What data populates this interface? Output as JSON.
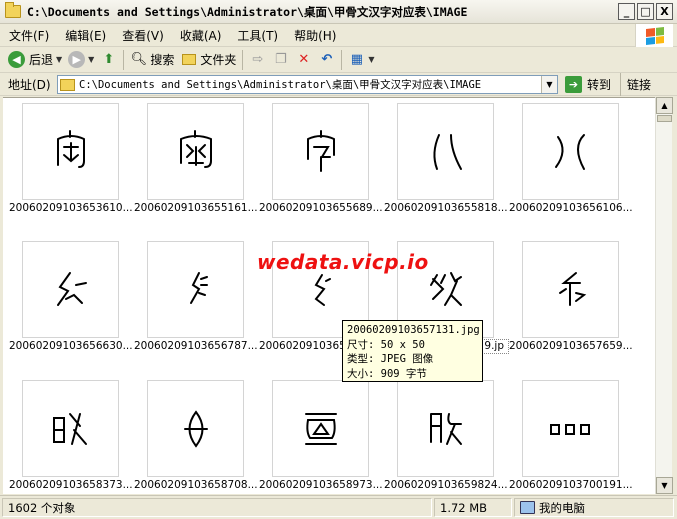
{
  "window": {
    "title": "C:\\Documents and Settings\\Administrator\\桌面\\甲骨文汉字对应表\\IMAGE",
    "minimize": "_",
    "maximize": "□",
    "close": "X"
  },
  "menu": [
    "文件(F)",
    "编辑(E)",
    "查看(V)",
    "收藏(A)",
    "工具(T)",
    "帮助(H)"
  ],
  "toolbar": {
    "back_label": "后退",
    "search_label": "搜索",
    "folders_label": "文件夹"
  },
  "address": {
    "label": "地址(D)",
    "value": "C:\\Documents and Settings\\Administrator\\桌面\\甲骨文汉字对应表\\IMAGE",
    "go_label": "转到",
    "links_label": "链接"
  },
  "files": [
    {
      "label": "20060209103653610...",
      "glyph": "g1"
    },
    {
      "label": "20060209103655161...",
      "glyph": "g2"
    },
    {
      "label": "20060209103655689...",
      "glyph": "g3"
    },
    {
      "label": "20060209103655818...",
      "glyph": "g4"
    },
    {
      "label": "20060209103656106...",
      "glyph": "g5"
    },
    {
      "label": "20060209103656630...",
      "glyph": "g6"
    },
    {
      "label": "20060209103656787...",
      "glyph": "g7"
    },
    {
      "label": "20060209103657",
      "glyph": "g8"
    },
    {
      "label": "9.jp",
      "glyph": "g9"
    },
    {
      "label": "20060209103657659...",
      "glyph": "g10"
    },
    {
      "label": "20060209103658373...",
      "glyph": "g11"
    },
    {
      "label": "20060209103658708...",
      "glyph": "g12"
    },
    {
      "label": "20060209103658973...",
      "glyph": "g13"
    },
    {
      "label": "20060209103659824...",
      "glyph": "g14"
    },
    {
      "label": "20060209103700191...",
      "glyph": "g15"
    }
  ],
  "tooltip": {
    "name": "20060209103657131.jpg",
    "size_dims": "尺寸: 50 x 50",
    "type": "类型: JPEG 图像",
    "filesize": "大小: 909 字节"
  },
  "watermark": "wedata.vicp.io",
  "status": {
    "count": "1602 个对象",
    "size": "1.72 MB",
    "location": "我的电脑"
  },
  "colors": {
    "accent_green": "#3b9c3b",
    "watermark_red": "#ee1111",
    "tooltip_bg": "#ffffe1"
  }
}
